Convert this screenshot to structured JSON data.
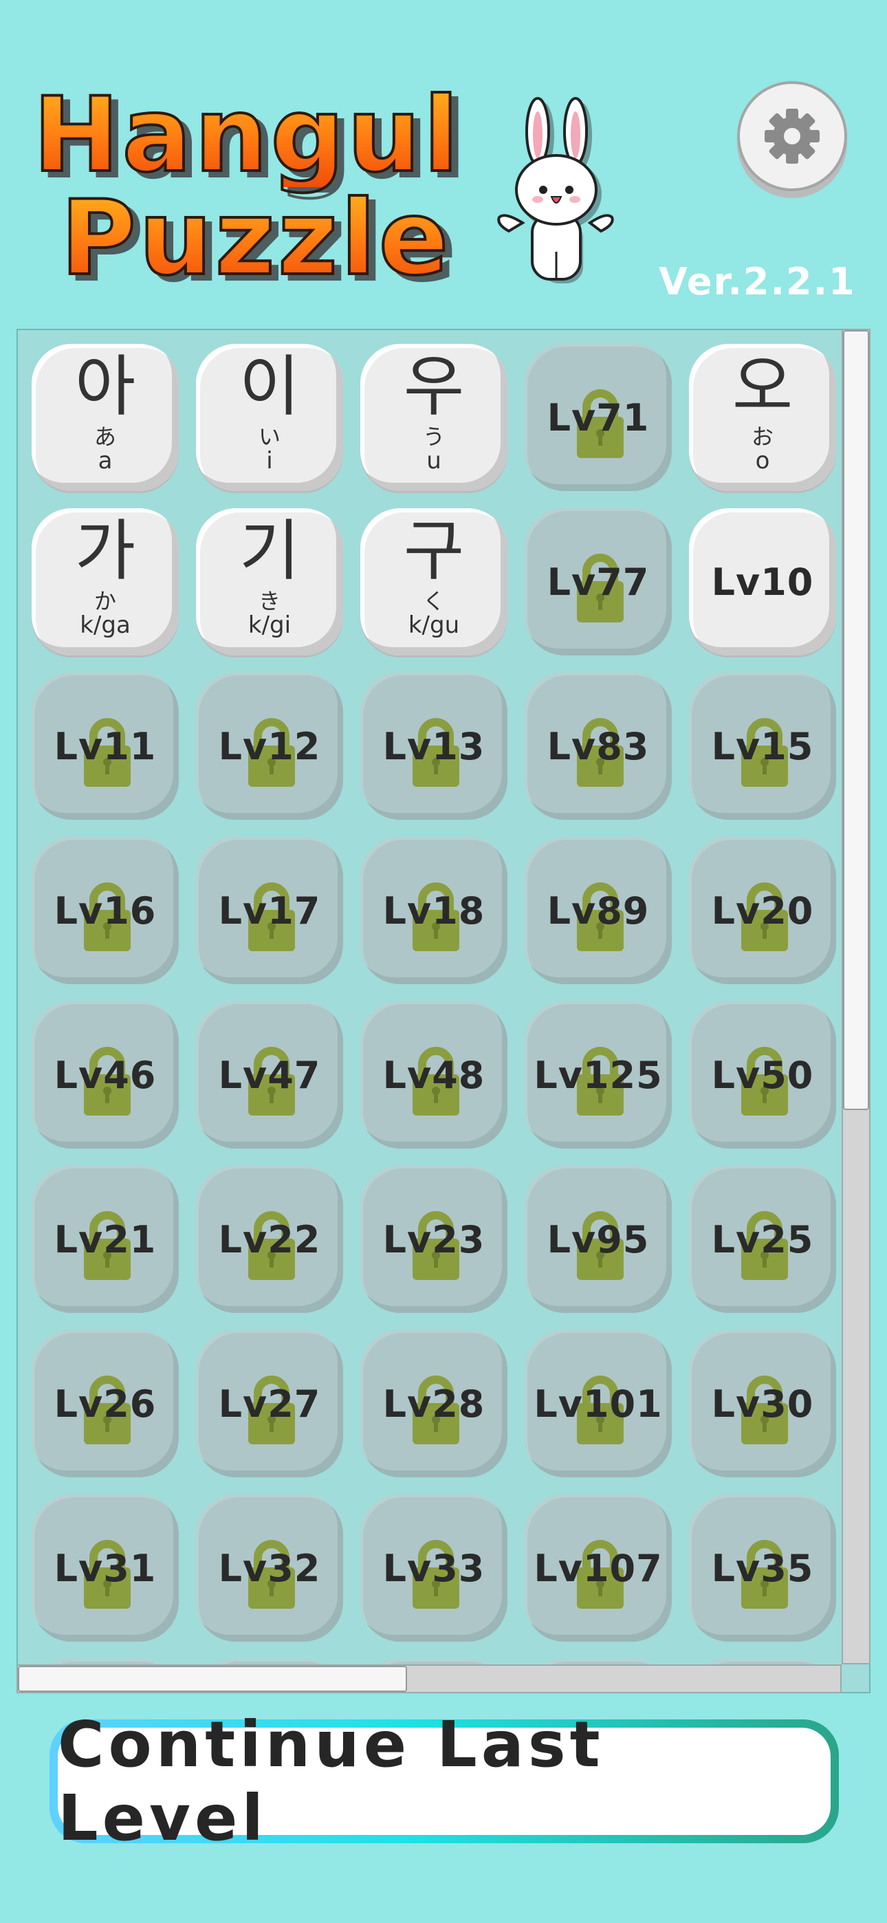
{
  "header": {
    "title_line1": "Hangul",
    "title_line2": "Puzzle",
    "version": "Ver.2.2.1"
  },
  "tiles": [
    {
      "type": "char",
      "hangul": "아",
      "kana": "あ",
      "romaji": "a"
    },
    {
      "type": "char",
      "hangul": "이",
      "kana": "い",
      "romaji": "i"
    },
    {
      "type": "char",
      "hangul": "우",
      "kana": "う",
      "romaji": "u"
    },
    {
      "type": "locked",
      "label": "Lv71"
    },
    {
      "type": "char",
      "hangul": "오",
      "kana": "お",
      "romaji": "o"
    },
    {
      "type": "char",
      "hangul": "가",
      "kana": "か",
      "romaji": "k/ga"
    },
    {
      "type": "char",
      "hangul": "기",
      "kana": "き",
      "romaji": "k/gi"
    },
    {
      "type": "char",
      "hangul": "구",
      "kana": "く",
      "romaji": "k/gu"
    },
    {
      "type": "locked",
      "label": "Lv77"
    },
    {
      "type": "level",
      "label": "Lv10"
    },
    {
      "type": "locked",
      "label": "Lv11"
    },
    {
      "type": "locked",
      "label": "Lv12"
    },
    {
      "type": "locked",
      "label": "Lv13"
    },
    {
      "type": "locked",
      "label": "Lv83"
    },
    {
      "type": "locked",
      "label": "Lv15"
    },
    {
      "type": "locked",
      "label": "Lv16"
    },
    {
      "type": "locked",
      "label": "Lv17"
    },
    {
      "type": "locked",
      "label": "Lv18"
    },
    {
      "type": "locked",
      "label": "Lv89"
    },
    {
      "type": "locked",
      "label": "Lv20"
    },
    {
      "type": "locked",
      "label": "Lv46"
    },
    {
      "type": "locked",
      "label": "Lv47"
    },
    {
      "type": "locked",
      "label": "Lv48"
    },
    {
      "type": "locked",
      "label": "Lv125"
    },
    {
      "type": "locked",
      "label": "Lv50"
    },
    {
      "type": "locked",
      "label": "Lv21"
    },
    {
      "type": "locked",
      "label": "Lv22"
    },
    {
      "type": "locked",
      "label": "Lv23"
    },
    {
      "type": "locked",
      "label": "Lv95"
    },
    {
      "type": "locked",
      "label": "Lv25"
    },
    {
      "type": "locked",
      "label": "Lv26"
    },
    {
      "type": "locked",
      "label": "Lv27"
    },
    {
      "type": "locked",
      "label": "Lv28"
    },
    {
      "type": "locked",
      "label": "Lv101"
    },
    {
      "type": "locked",
      "label": "Lv30"
    },
    {
      "type": "locked",
      "label": "Lv31"
    },
    {
      "type": "locked",
      "label": "Lv32"
    },
    {
      "type": "locked",
      "label": "Lv33"
    },
    {
      "type": "locked",
      "label": "Lv107"
    },
    {
      "type": "locked",
      "label": "Lv35"
    },
    {
      "type": "locked",
      "label": ""
    },
    {
      "type": "locked",
      "label": ""
    },
    {
      "type": "locked",
      "label": ""
    },
    {
      "type": "locked",
      "label": ""
    },
    {
      "type": "locked",
      "label": ""
    }
  ],
  "footer": {
    "continue_label": "Continue Last Level"
  },
  "icons": {
    "settings": "gear-icon",
    "lock": "lock-icon",
    "mascot": "bunny-mascot"
  },
  "colors": {
    "background": "#93e7e5",
    "lock": "#8b9e3f",
    "title_orange": "#ff7a12"
  }
}
